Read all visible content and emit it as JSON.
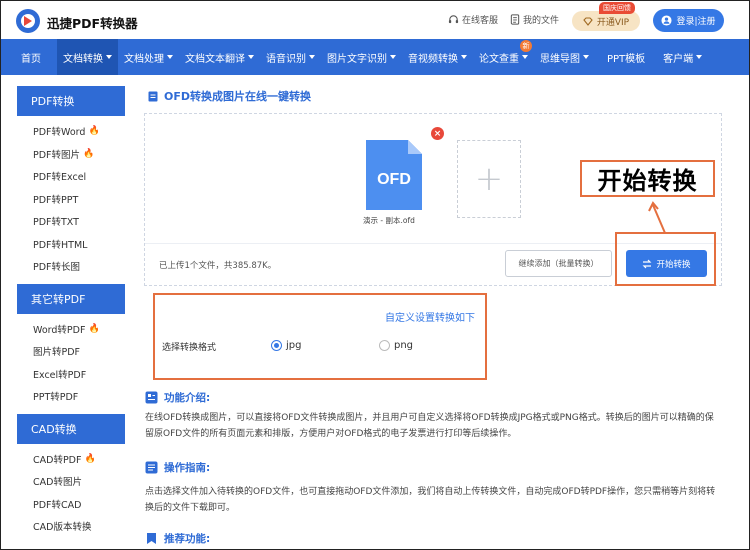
{
  "header": {
    "brand": "迅捷PDF转换器",
    "service": "在线客服",
    "my_files": "我的文件",
    "vip_badge": "国庆回馈",
    "vip_label": "开通VIP",
    "login_label": "登录|注册"
  },
  "nav": {
    "items": [
      {
        "label": "首页",
        "caret": false
      },
      {
        "label": "文档转换",
        "caret": true
      },
      {
        "label": "文档处理",
        "caret": true
      },
      {
        "label": "文档文本翻译",
        "caret": true
      },
      {
        "label": "语音识别",
        "caret": true
      },
      {
        "label": "图片文字识别",
        "caret": true
      },
      {
        "label": "音视频转换",
        "caret": true
      },
      {
        "label": "论文查重",
        "caret": true
      },
      {
        "label": "思维导图",
        "caret": true
      },
      {
        "label": "PPT模板",
        "caret": false
      },
      {
        "label": "客户端",
        "caret": true
      }
    ],
    "new_badge": "新"
  },
  "sidebar": {
    "groups": [
      {
        "title": "PDF转换",
        "items": [
          "PDF转Word",
          "PDF转图片",
          "PDF转Excel",
          "PDF转PPT",
          "PDF转TXT",
          "PDF转HTML",
          "PDF转长图"
        ]
      },
      {
        "title": "其它转PDF",
        "items": [
          "Word转PDF",
          "图片转PDF",
          "Excel转PDF",
          "PPT转PDF"
        ]
      },
      {
        "title": "CAD转换",
        "items": [
          "CAD转PDF",
          "CAD转图片",
          "PDF转CAD",
          "CAD版本转换"
        ]
      }
    ]
  },
  "main": {
    "title": "OFD转换成图片在线一键转换",
    "file_type": "OFD",
    "file_name": "演示 - 副本.ofd",
    "status": "已上传1个文件，共385.87K。",
    "continue_btn": "继续添加（批量转换）",
    "start_btn": "开始转换",
    "callout": "开始转换",
    "custom_link": "自定义设置转换如下",
    "format_label": "选择转换格式",
    "format_options": [
      "jpg",
      "png"
    ]
  },
  "sections": {
    "intro_title": "功能介绍:",
    "intro_text": "在线OFD转换成图片，可以直接将OFD文件转换成图片，并且用户可自定义选择将OFD转换成JPG格式或PNG格式。转换后的图片可以精确的保留原OFD文件的所有页面元素和排版，方便用户对OFD格式的电子发票进行打印等后续操作。",
    "guide_title": "操作指南:",
    "guide_text": "点击选择文件加入待转换的OFD文件，也可直接拖动OFD文件添加，我们将自动上传转换文件，自动完成OFD转PDF操作，您只需稍等片刻将转换后的文件下载即可。",
    "recommend_title": "推荐功能:"
  },
  "colors": {
    "primary": "#2f6bd5",
    "accent": "#3578e5",
    "highlight": "#e46f3f",
    "hot": "#f06a25"
  }
}
